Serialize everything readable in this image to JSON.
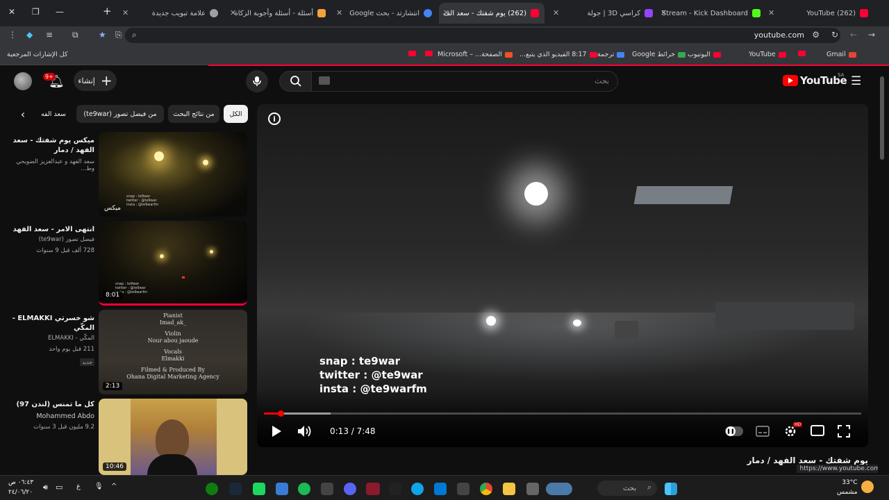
{
  "browser": {
    "tabs": [
      {
        "label": "(262) YouTube",
        "color": "#ff0033"
      },
      {
        "label": "Stream - Kick Dashboard",
        "color": "#53fc18"
      },
      {
        "label": "كراسي 3D | جولة",
        "color": "#9146ff"
      },
      {
        "label": "(262) يوم شفتك - سعد الف",
        "color": "#ff0033",
        "active": true
      },
      {
        "label": "انتشارتد - بحث Google",
        "color": "#4285f4"
      },
      {
        "label": "أسئلة - أسئلة وأجوبة الزكاة",
        "color": "#f4a23a"
      },
      {
        "label": "علامة تبويب جديدة",
        "color": "#9aa0a6"
      }
    ],
    "url": "youtube.com",
    "bookmarks": [
      {
        "label": "Gmail",
        "color": "#ea4335"
      },
      {
        "label": "",
        "color": "#ff0033"
      },
      {
        "label": "YouTube",
        "color": "#ff0033"
      },
      {
        "label": "اليوتيوب",
        "color": "#ff0033"
      },
      {
        "label": "خرائط Google",
        "color": "#34a853"
      },
      {
        "label": "ترجمة",
        "color": "#4285f4"
      },
      {
        "label": "8:17 الفيديو الذي يتبع...",
        "color": "#ff0033"
      },
      {
        "label": "الصفحة... – Microsoft",
        "color": "#f25022"
      },
      {
        "label": "",
        "color": "#ff0033"
      },
      {
        "label": "",
        "color": "#ff0033"
      }
    ],
    "bookmarks_all": "كل الإشارات المرجعية"
  },
  "header": {
    "search_placeholder": "بحث",
    "create_label": "إنشاء",
    "notif_count": "9+",
    "logo_word": "YouTube",
    "country": "SA"
  },
  "chips": [
    "الكل",
    "من نتائج البحث",
    "من فيصل تصور (te9war)",
    "سعد الفه"
  ],
  "related": [
    {
      "title": "ميكس يوم شفتك - سعد الفهد / دمار",
      "channel": "سعد الفهد و عبدالعزيز الضويحي وط...",
      "meta": "",
      "duration": "ميكس",
      "badge": ""
    },
    {
      "title": "انتهى الامر - سعد الفهد",
      "channel": "فيصل تصور (te9war)",
      "meta": "728 ألف  قبل 9 سنوات",
      "duration": "8:01",
      "badge": ""
    },
    {
      "title": "شو خسرتي ELMAKKI - المكّي",
      "channel": "المكّي - ELMAKKI",
      "meta": "211  قبل يوم واحد",
      "duration": "2:13",
      "badge": "جديد"
    },
    {
      "title": "كل ما تمنس (لندن 97)",
      "channel": "Mohammed Abdo",
      "meta": "9.2 مليون  قبل 3 سنوات",
      "duration": "10:46",
      "badge": ""
    }
  ],
  "thumb3_text": [
    "Pianist",
    "Imad_ak_",
    "Violin",
    "Nour abou jaoude",
    "Vocals",
    "Elmakki",
    "Filmed & Produced By",
    "Ohana Digital Marketing Agency"
  ],
  "thumb_small_text": [
    "snap : te9war",
    "twitter : @te9war",
    "insta : @te9warfm"
  ],
  "player": {
    "overlay": [
      "snap : te9war",
      "twitter : @te9war",
      "insta : @te9warfm"
    ],
    "time": "0:13 / 7:48",
    "progress": 0.028,
    "buffered": 0.112
  },
  "video_title": "يوم شفتك - سعد الفهد / دمار",
  "url_preview": "https://www.youtube.com",
  "taskbar": {
    "search": "بحث",
    "clock_time": "٠٦:٤٣ ص",
    "clock_date": "٢٤/٠٦/٢٠",
    "temp": "33°C",
    "weather": "مشمس"
  }
}
